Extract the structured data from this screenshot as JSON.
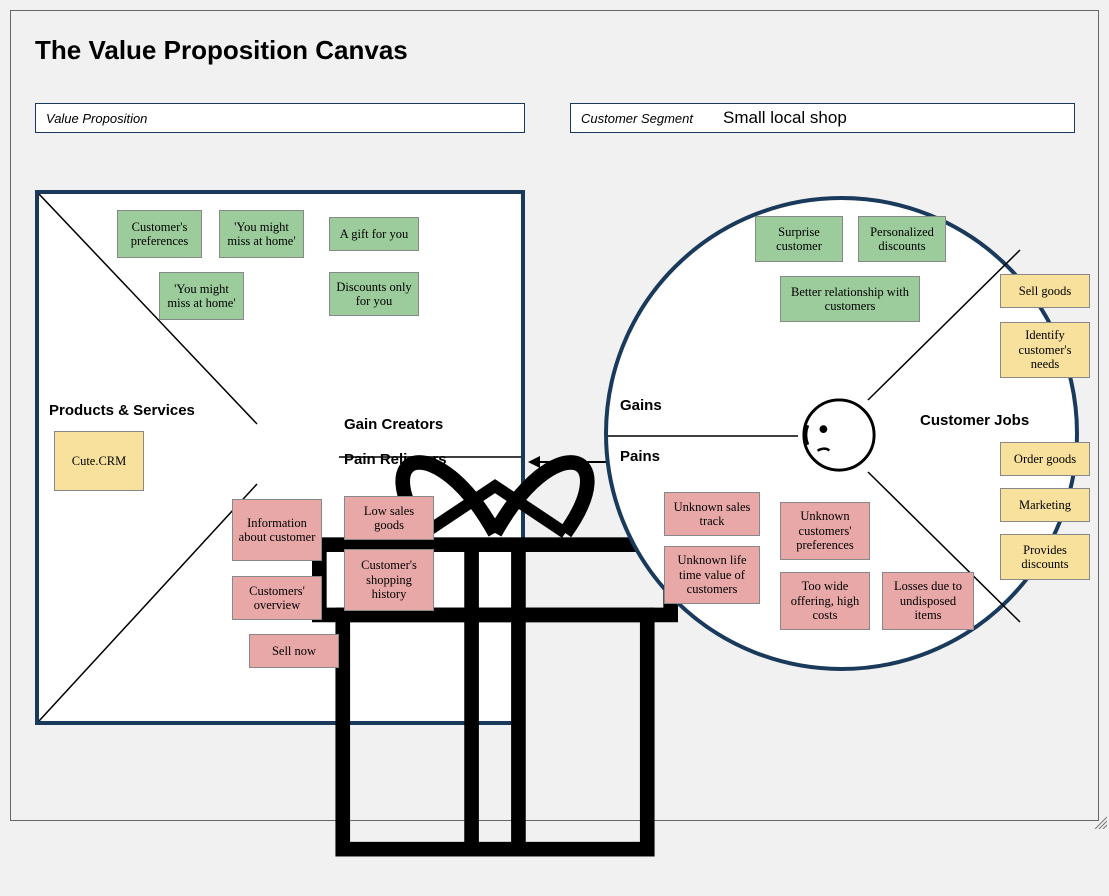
{
  "title": "The Value Proposition Canvas",
  "leftHeader": {
    "label": "Value Proposition",
    "value": ""
  },
  "rightHeader": {
    "label": "Customer Segment",
    "value": "Small local shop"
  },
  "sections": {
    "productsServices": "Products & Services",
    "gainCreators": "Gain Creators",
    "painRelievers": "Pain Relievers",
    "gains": "Gains",
    "pains": "Pains",
    "customerJobs": "Customer Jobs"
  },
  "vp": {
    "products": [
      "Cute.CRM"
    ],
    "gainCreators": [
      "Customer's preferences",
      "'You might miss at home'",
      "A gift for you",
      "'You might miss at home'",
      "Discounts only for you"
    ],
    "painRelievers": [
      "Information about customer",
      "Low sales goods",
      "Customer's shopping history",
      "Customers' overview",
      "Sell now"
    ]
  },
  "cs": {
    "gains": [
      "Surprise customer",
      "Personalized discounts",
      "Better relationship with customers"
    ],
    "pains": [
      "Unknown sales track",
      "Unknown life time value of customers",
      "Unknown customers' preferences",
      "Too wide offering, high costs",
      "Losses due to undisposed items"
    ],
    "jobs": [
      "Sell goods",
      "Identify customer's needs",
      "Order goods",
      "Marketing",
      "Provides discounts"
    ]
  }
}
